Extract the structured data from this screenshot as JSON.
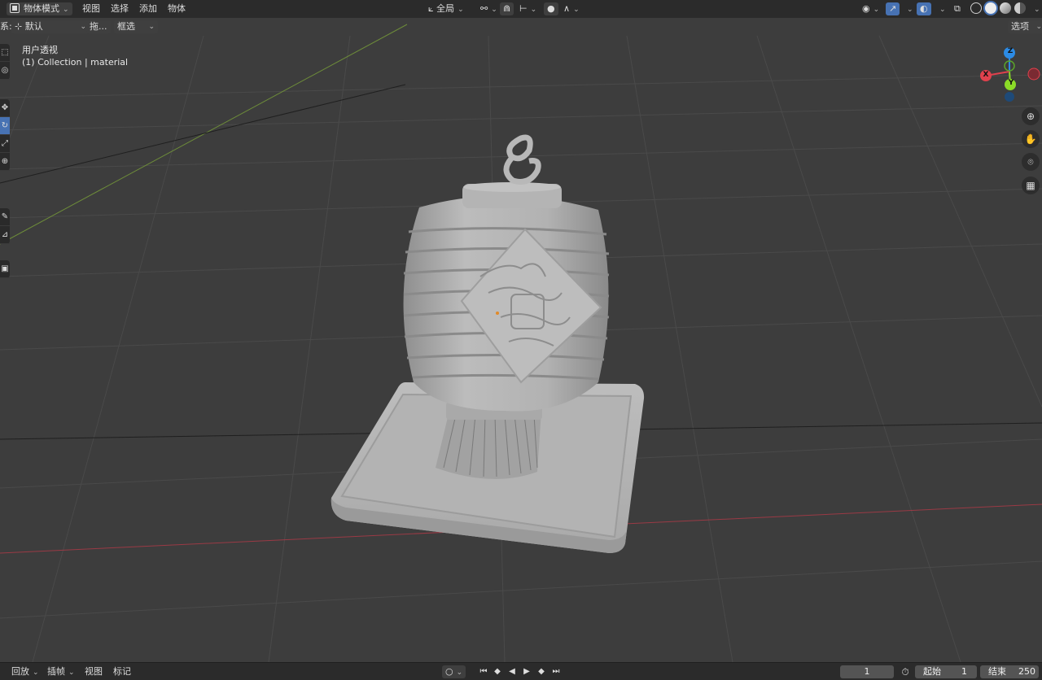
{
  "header": {
    "mode_label": "物体模式",
    "menus": [
      "视图",
      "选择",
      "添加",
      "物体"
    ],
    "transform_label": "全局",
    "options_label": "选项"
  },
  "subheader": {
    "orientation_prefix": "系:",
    "orientation_value": "默认",
    "drag_label": "拖...",
    "select_label": "框选"
  },
  "viewport": {
    "view_name": "用户透视",
    "collection_info": "(1) Collection | material",
    "gizmo": {
      "z": "Z",
      "y": "Y",
      "x": "X"
    }
  },
  "timeline": {
    "playback_label": "回放",
    "keying_label": "插帧",
    "view_label": "视图",
    "marker_label": "标记",
    "current_frame": "1",
    "start_label": "起始",
    "start_value": "1",
    "end_label": "结束",
    "end_value": "250"
  },
  "colors": {
    "x_axis": "#e0414d",
    "y_axis": "#8bdb27",
    "z_axis": "#2c8be5",
    "active_tool": "#4772b3",
    "model": "#b9b9b9"
  }
}
